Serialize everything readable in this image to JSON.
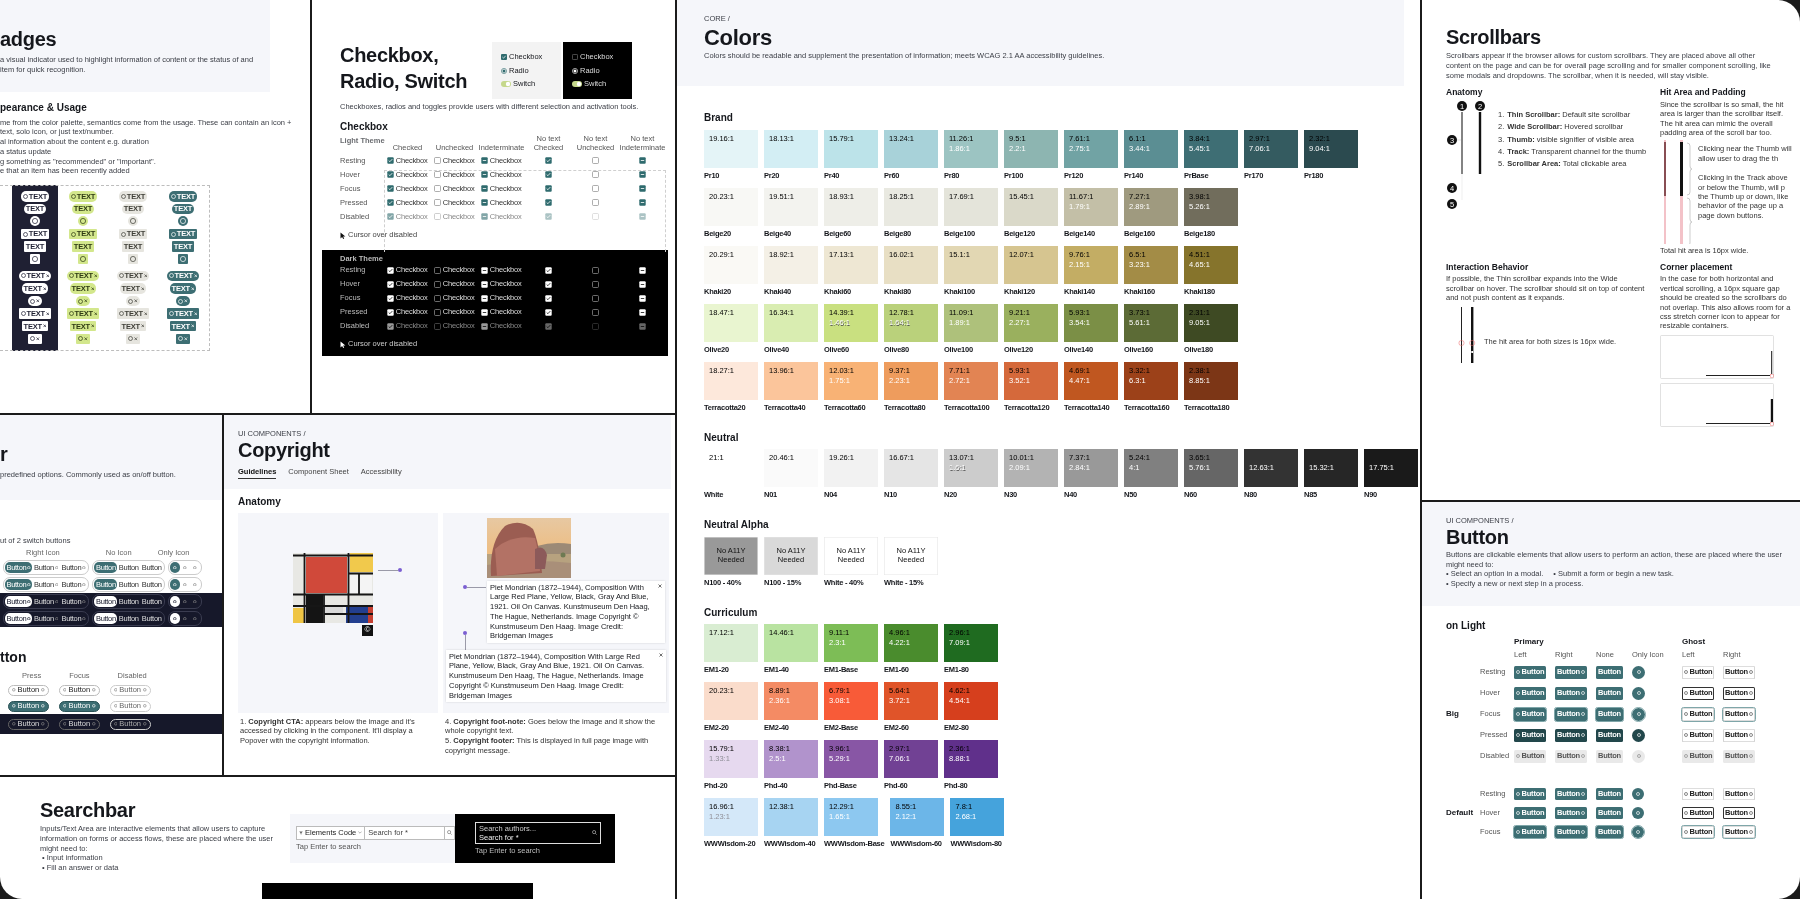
{
  "badges_page": {
    "title": "adges",
    "description": "a visual indicator used to highlight information of content or the status of and item for quick recognition.",
    "usage_heading": "pearance & Usage",
    "usage_points": [
      "me from the color palette, semantics come from the usage. These can contain an icon + text, solo icon, or just text/number.",
      "al information about the content e.g. duration",
      "a status update",
      "g something as \"recommended\" or \"important\".",
      "e that an item has been recently added"
    ],
    "columns": [
      {
        "kind": "dark"
      },
      {
        "kind": "lime"
      },
      {
        "kind": "gray"
      },
      {
        "kind": "teal"
      }
    ],
    "groups": [
      {
        "rows": [
          {
            "kind": "pill",
            "icon": true,
            "dismissible": false,
            "texts": [
              "TEXT",
              "TEXT",
              "TEXT",
              "TEXT"
            ]
          },
          {
            "kind": "pill",
            "icon": false,
            "dismissible": false,
            "texts": [
              "TEXT",
              "TEXT",
              "TEXT",
              "TEXT"
            ]
          },
          {
            "kind": "pill",
            "icon": true,
            "dismissible": false
          },
          {
            "kind": "square",
            "icon": true,
            "dismissible": false,
            "texts": [
              "TEXT",
              "TEXT",
              "TEXT",
              "TEXT"
            ]
          },
          {
            "kind": "square",
            "icon": false,
            "dismissible": false,
            "texts": [
              "TEXT",
              "TEXT",
              "TEXT",
              "TEXT"
            ]
          },
          {
            "kind": "square",
            "icon": true,
            "dismissible": false
          }
        ]
      },
      {
        "rows": [
          {
            "kind": "pill",
            "icon": true,
            "dismissible": true,
            "texts": [
              "TEXT",
              "TEXT",
              "TEXT",
              "TEXT"
            ]
          },
          {
            "kind": "pill",
            "icon": false,
            "dismissible": true,
            "texts": [
              "TEXT",
              "TEXT",
              "TEXT",
              "TEXT"
            ]
          },
          {
            "kind": "pill",
            "icon": true,
            "dismissible": true
          },
          {
            "kind": "square",
            "icon": true,
            "dismissible": true,
            "texts": [
              "TEXT",
              "TEXT",
              "TEXT",
              "TEXT"
            ]
          },
          {
            "kind": "square",
            "icon": false,
            "dismissible": true,
            "texts": [
              "TEXT",
              "TEXT",
              "TEXT",
              "TEXT"
            ]
          },
          {
            "kind": "square",
            "icon": true,
            "dismissible": true
          }
        ]
      }
    ]
  },
  "selection_page": {
    "title": "Checkbox, Radio, Switch",
    "description": "Checkboxes, radios and toggles provide users with different selection and activation tools.",
    "previews": [
      {
        "kind": "light",
        "items": [
          {
            "kind": "checkbox",
            "label": "Checkbox",
            "on": true
          },
          {
            "kind": "radio",
            "label": "Radio",
            "on": true
          },
          {
            "kind": "switch",
            "label": "Switch",
            "on": true
          }
        ]
      },
      {
        "kind": "dark",
        "items": [
          {
            "kind": "checkbox",
            "label": "Checkbox",
            "on": false
          },
          {
            "kind": "radio",
            "label": "Radio",
            "on": true
          },
          {
            "kind": "switch",
            "label": "Switch",
            "on": true
          }
        ]
      }
    ],
    "section": "Checkbox",
    "columns": [
      {
        "label": "Checked",
        "kind": "checked"
      },
      {
        "label": "Unchecked",
        "kind": "unchecked"
      },
      {
        "label": "Indeterminate",
        "kind": "indeterminate"
      },
      {
        "label": "No text Checked",
        "kind": "checked"
      },
      {
        "label": "No text Unchecked",
        "kind": "unchecked"
      },
      {
        "label": "No text Indeterminate",
        "kind": "indeterminate"
      }
    ],
    "themes": [
      {
        "kind": "light",
        "label": "Light Theme",
        "note": "Cursor over disabled",
        "rows": [
          {
            "label": "Resting",
            "disabled": false,
            "texts": [
              "Checkbox",
              "Checkbox",
              "Checkbox"
            ]
          },
          {
            "label": "Hover",
            "disabled": false,
            "texts": [
              "Checkbox",
              "Checkbox",
              "Checkbox"
            ]
          },
          {
            "label": "Focus",
            "disabled": false,
            "texts": [
              "Checkbox",
              "Checkbox",
              "Checkbox"
            ]
          },
          {
            "label": "Pressed",
            "disabled": false,
            "texts": [
              "Checkbox",
              "Checkbox",
              "Checkbox"
            ]
          },
          {
            "label": "Disabled",
            "disabled": true,
            "texts": [
              "Checkbox",
              "Checkbox",
              "Checkbox"
            ]
          }
        ]
      },
      {
        "kind": "dark",
        "label": "Dark Theme",
        "note": "Cursor over disabled",
        "rows": [
          {
            "label": "Resting",
            "disabled": false,
            "texts": [
              "Checkbox",
              "Checkbox",
              "Checkbox"
            ]
          },
          {
            "label": "Hover",
            "disabled": false,
            "texts": [
              "Checkbox",
              "Checkbox",
              "Checkbox"
            ]
          },
          {
            "label": "Focus",
            "disabled": false,
            "texts": [
              "Checkbox",
              "Checkbox",
              "Checkbox"
            ]
          },
          {
            "label": "Pressed",
            "disabled": false,
            "texts": [
              "Checkbox",
              "Checkbox",
              "Checkbox"
            ]
          },
          {
            "label": "Disabled",
            "disabled": true,
            "texts": [
              "Checkbox",
              "Checkbox",
              "Checkbox"
            ]
          }
        ]
      }
    ]
  },
  "switch_page": {
    "title": "r",
    "description": "predefined options. Commonly used as on/off button.",
    "subtitle": "ut of 2 switch buttons",
    "headers": [
      "Right Icon",
      "No Icon",
      "Only Icon"
    ],
    "rows": [
      {
        "kind": "light",
        "texts": [
          "Button",
          "Button",
          "Button",
          "Button",
          "Button",
          "Button"
        ]
      },
      {
        "kind": "light",
        "texts": [
          "Button",
          "Button",
          "Button",
          "Button",
          "Button",
          "Button"
        ]
      },
      {
        "kind": "dark",
        "texts": [
          "Button",
          "Button",
          "Button",
          "Button",
          "Button",
          "Button"
        ]
      },
      {
        "kind": "dark",
        "texts": [
          "Button",
          "Button",
          "Button",
          "Button",
          "Button",
          "Button"
        ]
      }
    ],
    "heading": "tton",
    "states": [
      "Press",
      "Focus",
      "Disabled"
    ],
    "button_rows": [
      {
        "kind": "light",
        "filled": false,
        "texts": [
          "Button",
          "Button",
          "Button"
        ]
      },
      {
        "kind": "light",
        "filled": true,
        "texts": [
          "Button",
          "Button",
          "Button"
        ]
      },
      {
        "kind": "dark",
        "filled": false,
        "texts": [
          "Button",
          "Button",
          "Button"
        ]
      }
    ]
  },
  "copyright_page": {
    "breadcrumb": "UI COMPONENTS /",
    "title": "Copyright",
    "tabs": [
      {
        "label": "Guidelines",
        "selected": true
      },
      {
        "label": "Component Sheet",
        "selected": false
      },
      {
        "label": "Accessibility",
        "selected": false
      }
    ],
    "section": "Anatomy",
    "cta": "©",
    "popover": "Piet Mondrian (1872–1944), Composition With Large Red Plane, Yellow, Black, Gray And Blue, 1921. Oil On Canvas. Kunstmuseum Den Haag, The Hague, Netherlands. Image Copyright © Kunstmuseum Den Haag. Image Credit: Bridgeman Images",
    "footer": "Piet Mondrian (1872–1944), Composition With Large Red Plane, Yellow, Black, Gray And Blue, 1921. Oil On Canvas. Kunstmuseum Den Haag, The Hague, Netherlands. Image Copyright © Kunstmuseum Den Haag. Image Credit: Bridgeman Images",
    "notes_left": [
      "1. **Copyright CTA:** appears below the image and it's accessed by clicking in the component. It'll display a Popover with the copyright information."
    ],
    "notes_right": [
      "4. **Copyright foot-note:** Goes below the image and it show the whole copyright text.",
      "5. **Copyright footer:** This is displayed in full page image with copyright message."
    ]
  },
  "searchbar_page": {
    "title": "Searchbar",
    "description": "Inputs/Text Area are interactive elements that allow users to capture information on forms or access flows, these are placed where the user might need to:",
    "points": [
      "• Input information",
      "• Fill an answer or data"
    ],
    "light": {
      "select": "Elements Code",
      "placeholder": "Search for *",
      "hint": "Tap Enter to search"
    },
    "dark": {
      "label": "Search authors...",
      "placeholder": "Search for *",
      "hint": "Tap Enter to search"
    }
  },
  "colors_page": {
    "breadcrumb": "CORE /",
    "title": "Colors",
    "description": "Colors should be readable and supplement the presentation of information; meets WCAG 2.1 AA accessibility guidelines.",
    "groups": [
      {
        "title": "Brand",
        "rows": [
          [
            {
              "name": "Pr10",
              "color": "#e4f4f7",
              "dark_ratio": "19.16:1"
            },
            {
              "name": "Pr20",
              "color": "#d3eef4",
              "dark_ratio": "18.13:1"
            },
            {
              "name": "Pr40",
              "color": "#bce3e9",
              "dark_ratio": "15.79:1"
            },
            {
              "name": "Pr60",
              "color": "#a8d2d9",
              "dark_ratio": "13.24:1"
            },
            {
              "name": "Pr80",
              "color": "#9cc4c2",
              "dark_ratio": "11.26:1",
              "light_ratio": "1.86:1"
            },
            {
              "name": "Pr100",
              "color": "#8db5b1",
              "dark_ratio": "9.5:1",
              "light_ratio": "2.2:1"
            },
            {
              "name": "Pr120",
              "color": "#71a3a4",
              "dark_ratio": "7.61:1",
              "light_ratio": "2.75:1"
            },
            {
              "name": "Pr140",
              "color": "#5b8e93",
              "dark_ratio": "6.1:1",
              "light_ratio": "3.44:1"
            },
            {
              "name": "PrBase",
              "color": "#3e6e74",
              "dark_ratio": "3.84:1",
              "light_ratio": "5.45:1"
            },
            {
              "name": "Pr170",
              "color": "#345b60",
              "dark_ratio": "2.97:1",
              "light_ratio": "7.06:1"
            },
            {
              "name": "Pr180",
              "color": "#2b4a4f",
              "dark_ratio": "2.32:1",
              "light_ratio": "9.04:1"
            }
          ],
          [
            {
              "name": "Beige20",
              "color": "#f8f8f5",
              "dark_ratio": "20.23:1"
            },
            {
              "name": "Beige40",
              "color": "#f3f3ef",
              "dark_ratio": "19.51:1"
            },
            {
              "name": "Beige60",
              "color": "#eeeee8",
              "dark_ratio": "18.93:1"
            },
            {
              "name": "Beige80",
              "color": "#e9e9e1",
              "dark_ratio": "18.25:1"
            },
            {
              "name": "Beige100",
              "color": "#e4e4da",
              "dark_ratio": "17.69:1"
            },
            {
              "name": "Beige120",
              "color": "#dad9c9",
              "dark_ratio": "15.45:1"
            },
            {
              "name": "Beige140",
              "color": "#c3bfa7",
              "dark_ratio": "11.67:1",
              "light_ratio": "1.79:1"
            },
            {
              "name": "Beige160",
              "color": "#9f9a7f",
              "dark_ratio": "7.27:1",
              "light_ratio": "2.89:1"
            },
            {
              "name": "Beige180",
              "color": "#716d5c",
              "dark_ratio": "3.98:1",
              "light_ratio": "5.26:1"
            }
          ],
          [
            {
              "name": "Khaki20",
              "color": "#faf9f5",
              "dark_ratio": "20.29:1"
            },
            {
              "name": "Khaki40",
              "color": "#f4f0e6",
              "dark_ratio": "18.92:1"
            },
            {
              "name": "Khaki60",
              "color": "#eee7d3",
              "dark_ratio": "17.13:1"
            },
            {
              "name": "Khaki80",
              "color": "#e8dfc4",
              "dark_ratio": "16.02:1"
            },
            {
              "name": "Khaki100",
              "color": "#e2d7b3",
              "dark_ratio": "15.1:1"
            },
            {
              "name": "Khaki120",
              "color": "#d6c590",
              "dark_ratio": "12.07:1"
            },
            {
              "name": "Khaki140",
              "color": "#c3ad64",
              "dark_ratio": "9.76:1",
              "light_ratio": "2.15:1"
            },
            {
              "name": "Khaki160",
              "color": "#a38c46",
              "dark_ratio": "6.5:1",
              "light_ratio": "3.23:1"
            },
            {
              "name": "Khaki180",
              "color": "#86742c",
              "dark_ratio": "4.51:1",
              "light_ratio": "4.65:1"
            }
          ],
          [
            {
              "name": "Olive20",
              "color": "#e9f5d0",
              "dark_ratio": "18.47:1"
            },
            {
              "name": "Olive40",
              "color": "#d9edb1",
              "dark_ratio": "16.34:1"
            },
            {
              "name": "Olive60",
              "color": "#c9e080",
              "dark_ratio": "14.39:1",
              "light_ratio": "1.46:1"
            },
            {
              "name": "Olive80",
              "color": "#bad17b",
              "dark_ratio": "12.78:1",
              "light_ratio": "1.64:1"
            },
            {
              "name": "Olive100",
              "color": "#aec17b",
              "dark_ratio": "11.09:1",
              "light_ratio": "1.89:1"
            },
            {
              "name": "Olive120",
              "color": "#9ab05e",
              "dark_ratio": "9.21:1",
              "light_ratio": "2.27:1"
            },
            {
              "name": "Olive140",
              "color": "#7b8f46",
              "dark_ratio": "5.93:1",
              "light_ratio": "3.54:1"
            },
            {
              "name": "Olive160",
              "color": "#5c6b36",
              "dark_ratio": "3.73:1",
              "light_ratio": "5.61:1"
            },
            {
              "name": "Olive180",
              "color": "#3e4a23",
              "dark_ratio": "2.31:1",
              "light_ratio": "9.05:1"
            }
          ],
          [
            {
              "name": "Terracotta20",
              "color": "#fde8db",
              "dark_ratio": "18.27:1"
            },
            {
              "name": "Terracotta40",
              "color": "#fbc59b",
              "dark_ratio": "13.96:1"
            },
            {
              "name": "Terracotta60",
              "color": "#f8b275",
              "dark_ratio": "12.03:1",
              "light_ratio": "1.75:1"
            },
            {
              "name": "Terracotta80",
              "color": "#ee9c5d",
              "dark_ratio": "9.37:1",
              "light_ratio": "2.23:1"
            },
            {
              "name": "Terracotta100",
              "color": "#e28453",
              "dark_ratio": "7.71:1",
              "light_ratio": "2.72:1"
            },
            {
              "name": "Terracotta120",
              "color": "#d5693b",
              "dark_ratio": "5.93:1",
              "light_ratio": "3.52:1"
            },
            {
              "name": "Terracotta140",
              "color": "#c05720",
              "dark_ratio": "4.69:1",
              "light_ratio": "4.47:1"
            },
            {
              "name": "Terracotta160",
              "color": "#9c4119",
              "dark_ratio": "3.32:1",
              "light_ratio": "6.3:1"
            },
            {
              "name": "Terracotta180",
              "color": "#7c3616",
              "dark_ratio": "2.38:1",
              "light_ratio": "8.85:1"
            }
          ]
        ]
      },
      {
        "title": "Neutral",
        "rows": [
          [
            {
              "name": "White",
              "color": "#ffffff",
              "dark_ratio": "21:1"
            },
            {
              "name": "N01",
              "color": "#fafafa",
              "dark_ratio": "20.46:1"
            },
            {
              "name": "N04",
              "color": "#f2f2f2",
              "dark_ratio": "19.26:1"
            },
            {
              "name": "N10",
              "color": "#e5e5e5",
              "dark_ratio": "16.67:1"
            },
            {
              "name": "N20",
              "color": "#cccccc",
              "dark_ratio": "13.07:1",
              "light_ratio": "1.6:1"
            },
            {
              "name": "N30",
              "color": "#b3b3b3",
              "dark_ratio": "10.01:1",
              "light_ratio": "2.09:1"
            },
            {
              "name": "N40",
              "color": "#999999",
              "dark_ratio": "7.37:1",
              "light_ratio": "2.84:1"
            },
            {
              "name": "N50",
              "color": "#808080",
              "dark_ratio": "5.24:1",
              "light_ratio": "4:1"
            },
            {
              "name": "N60",
              "color": "#666666",
              "dark_ratio": "3.65:1",
              "light_ratio": "5.76:1"
            },
            {
              "name": "N80",
              "color": "#333333",
              "light_ratio": "12.63:1"
            },
            {
              "name": "N85",
              "color": "#262626",
              "light_ratio": "15.32:1"
            },
            {
              "name": "N90",
              "color": "#1a1a1a",
              "light_ratio": "17.75:1"
            }
          ]
        ]
      },
      {
        "title": "Neutral Alpha",
        "rows": [
          [
            {
              "name": "N100 - 40%",
              "color": "#999999",
              "label": "No A11Y Needed"
            },
            {
              "name": "N100 - 15%",
              "color": "#d9d9d9",
              "label": "No A11Y Needed"
            },
            {
              "name": "White - 40%",
              "color": "#ffffff",
              "label": "No A11Y Needed"
            },
            {
              "name": "White - 15%",
              "color": "#ffffff",
              "label": "No A11Y Needed"
            }
          ]
        ]
      },
      {
        "title": "Curriculum",
        "rows": [
          [
            {
              "name": "EM1-20",
              "color": "#d9edd2",
              "dark_ratio": "17.12:1"
            },
            {
              "name": "EM1-40",
              "color": "#b9e3a1",
              "dark_ratio": "14.46:1"
            },
            {
              "name": "EM1-Base",
              "color": "#7dbd56",
              "dark_ratio": "9.11:1",
              "light_ratio": "2.3:1"
            },
            {
              "name": "EM1-60",
              "color": "#4a8c2d",
              "dark_ratio": "4.96:1",
              "light_ratio": "4.22:1"
            },
            {
              "name": "EM1-80",
              "color": "#1f6b20",
              "dark_ratio": "2.96:1",
              "light_ratio": "7.09:1"
            }
          ],
          [
            {
              "name": "EM2-20",
              "color": "#fadccb",
              "dark_ratio": "20.23:1"
            },
            {
              "name": "EM2-40",
              "color": "#f48b64",
              "dark_ratio": "8.89:1",
              "light_ratio": "2.36:1"
            },
            {
              "name": "EM2-Base",
              "color": "#f85b38",
              "dark_ratio": "6.79:1",
              "light_ratio": "3.08:1"
            },
            {
              "name": "EM2-60",
              "color": "#e05429",
              "dark_ratio": "5.64:1",
              "light_ratio": "3.72:1"
            },
            {
              "name": "EM2-80",
              "color": "#d63f1d",
              "dark_ratio": "4.62:1",
              "light_ratio": "4.54:1"
            }
          ],
          [
            {
              "name": "Phd-20",
              "color": "#e6d9ef",
              "dark_ratio": "15.79:1",
              "light_ratio": "1.33:1"
            },
            {
              "name": "Phd-40",
              "color": "#b193cc",
              "dark_ratio": "8.38:1",
              "light_ratio": "2.5:1"
            },
            {
              "name": "Phd-Base",
              "color": "#8856a5",
              "dark_ratio": "3.96:1",
              "light_ratio": "5.29:1"
            },
            {
              "name": "Phd-60",
              "color": "#714194",
              "dark_ratio": "2.97:1",
              "light_ratio": "7.06:1"
            },
            {
              "name": "Phd-80",
              "color": "#60308b",
              "dark_ratio": "2.36:1",
              "light_ratio": "8.88:1"
            }
          ],
          [
            {
              "name": "WWWisdom-20",
              "color": "#d4e8f9",
              "dark_ratio": "16.96:1",
              "light_ratio": "1.23:1"
            },
            {
              "name": "WWWisdom-40",
              "color": "#a7d4f2",
              "dark_ratio": "12.38:1"
            },
            {
              "name": "WWWisdom-Base",
              "color": "#8dc8f0",
              "dark_ratio": "12.29:1",
              "light_ratio": "1.65:1"
            },
            {
              "name": "WWWisdom-60",
              "color": "#6cb6e8",
              "dark_ratio": "8.55:1",
              "light_ratio": "2.12:1"
            },
            {
              "name": "WWWisdom-80",
              "color": "#45a3dc",
              "dark_ratio": "7.8:1",
              "light_ratio": "2.68:1"
            }
          ]
        ]
      }
    ]
  },
  "scrollbars_page": {
    "title": "Scrollbars",
    "description": "Scrollbars appear if the browser allows for custom scrollbars. They are placed above all other content on the page and can be for overall page scrolling and for smaller component scrolling, like some modals and dropdowns. The scrollbar, when it is needed, will stay visible.",
    "anatomy_heading": "Anatomy",
    "markers": [
      "1",
      "2",
      "3",
      "4",
      "5"
    ],
    "anatomy_items": [
      {
        "number": "1.",
        "text": "**Thin Scrollbar:** Default site scrollbar"
      },
      {
        "number": "2.",
        "text": "**Wide Scrollbar:** Hovered scrollbar"
      },
      {
        "number": "3.",
        "text": "**Thumb:** visible signifier of visible area"
      },
      {
        "number": "4.",
        "text": "**Track:** Transparent channel for the thumb"
      },
      {
        "number": "5.",
        "text": "**Scrollbar Area:** Total clickable area"
      }
    ],
    "hit_heading": "Hit Area and Padding",
    "hit_description": "Since the scrollbar is so small, the hit area is larger than the scrollbar itself. The hit area can mimic the overall padding area of the scroll bar too.",
    "hit_notes": [
      "Clicking near the Thumb will allow user to drag the th",
      "Clicking in the Track above or below the Thumb, will p the Thumb up or down, like behavior of the page up a page down buttons."
    ],
    "hit_total": "Total hit area is 16px wide.",
    "interaction_heading": "Interaction Behavior",
    "interaction_description": "If possible, the Thin scrollbar expands into the Wide scrollbar on hover. The scrollbar should sit on top of content and not push content as it expands.",
    "interaction_note": "The hit area for both sizes is 16px wide.",
    "corner_heading": "Corner placement",
    "corner_description": "In the case for both horizontal and vertical scrolling, a 16px square gap should be created so the scrollbars do not overlap. This also allows room for a css stretch corner icon to appear for resizable containers."
  },
  "button_page": {
    "breadcrumb": "UI COMPONENTS /",
    "title": "Button",
    "description": "Buttons are clickable elements that allow users to perform an action, these are placed where the user might need to:",
    "points": [
      "• Select an option in a modal.",
      "• Submit a form or begin a new task.",
      "• Specify a new or next step in a process."
    ],
    "section": "on Light",
    "variants": [
      {
        "label": "Primary",
        "kind": "primary",
        "columns": [
          {
            "label": "Left",
            "kind": "left"
          },
          {
            "label": "Right",
            "kind": "right"
          },
          {
            "label": "None",
            "kind": "none"
          },
          {
            "label": "Only Icon",
            "kind": "only"
          }
        ]
      },
      {
        "label": "Ghost",
        "kind": "ghost",
        "columns": [
          {
            "label": "Left",
            "kind": "left"
          },
          {
            "label": "Right",
            "kind": "right"
          }
        ]
      }
    ],
    "sizes": [
      {
        "label": "Big",
        "kind": "big",
        "rows": [
          {
            "label": "Resting",
            "kind": "resting",
            "texts": [
              "Button",
              "Button",
              "Button",
              "Button",
              "Button"
            ]
          },
          {
            "label": "Hover",
            "kind": "hover",
            "texts": [
              "Button",
              "Button",
              "Button",
              "Button",
              "Button"
            ]
          },
          {
            "label": "Focus",
            "kind": "focus",
            "texts": [
              "Button",
              "Button",
              "Button",
              "Button",
              "Button"
            ]
          },
          {
            "label": "Pressed",
            "kind": "pressed",
            "texts": [
              "Button",
              "Button",
              "Button",
              "Button",
              "Button"
            ]
          },
          {
            "label": "Disabled",
            "kind": "disabled",
            "texts": [
              "Button",
              "Button",
              "Button",
              "Button",
              "Button"
            ]
          }
        ]
      },
      {
        "label": "Default",
        "kind": "default",
        "rows": [
          {
            "label": "Resting",
            "kind": "resting",
            "texts": [
              "Button",
              "Button",
              "Button",
              "Button",
              "Button"
            ]
          },
          {
            "label": "Hover",
            "kind": "hover",
            "texts": [
              "Button",
              "Button",
              "Button",
              "Button",
              "Button"
            ]
          },
          {
            "label": "Focus",
            "kind": "focus",
            "texts": [
              "Button",
              "Button",
              "Button",
              "Button",
              "Button"
            ]
          }
        ]
      }
    ]
  }
}
